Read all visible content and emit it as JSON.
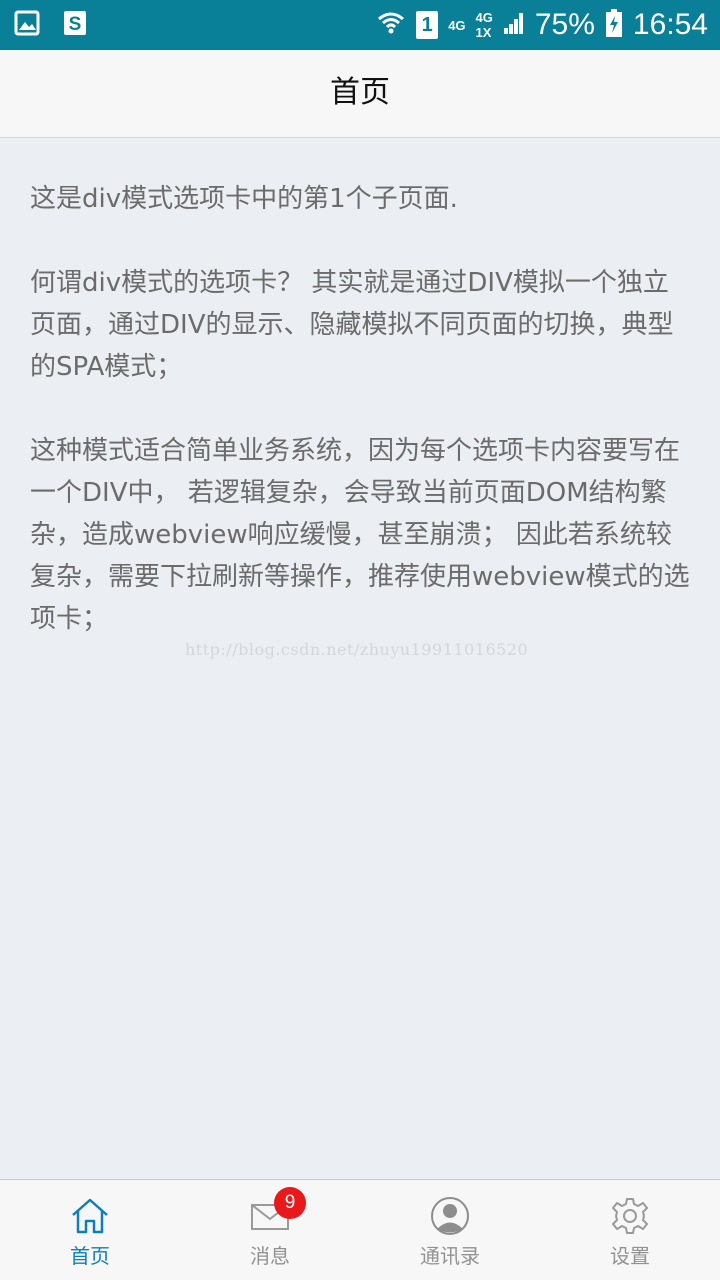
{
  "status_bar": {
    "network_labels": [
      "4G",
      "4G",
      "1X"
    ],
    "sim_label": "1",
    "battery_percent": "75%",
    "time": "16:54",
    "icons": [
      "gallery-icon",
      "s-app-icon",
      "wifi-icon",
      "sim-icon",
      "signal-icon",
      "battery-charging-icon"
    ]
  },
  "header": {
    "title": "首页"
  },
  "content": {
    "paragraphs": [
      "这是div模式选项卡中的第1个子页面.",
      "何谓div模式的选项卡？ 其实就是通过DIV模拟一个独立页面，通过DIV的显示、隐藏模拟不同页面的切换，典型的SPA模式；",
      "这种模式适合简单业务系统，因为每个选项卡内容要写在一个DIV中， 若逻辑复杂，会导致当前页面DOM结构繁杂，造成webview响应缓慢，甚至崩溃； 因此若系统较复杂，需要下拉刷新等操作，推荐使用webview模式的选项卡；"
    ],
    "watermark": "http://blog.csdn.net/zhuyu19911016520"
  },
  "tabbar": {
    "accent_color": "#0e80b8",
    "items": [
      {
        "label": "首页",
        "icon": "home-icon",
        "active": true
      },
      {
        "label": "消息",
        "icon": "mail-icon",
        "badge": "9"
      },
      {
        "label": "通讯录",
        "icon": "contact-icon"
      },
      {
        "label": "设置",
        "icon": "gear-icon"
      }
    ]
  }
}
